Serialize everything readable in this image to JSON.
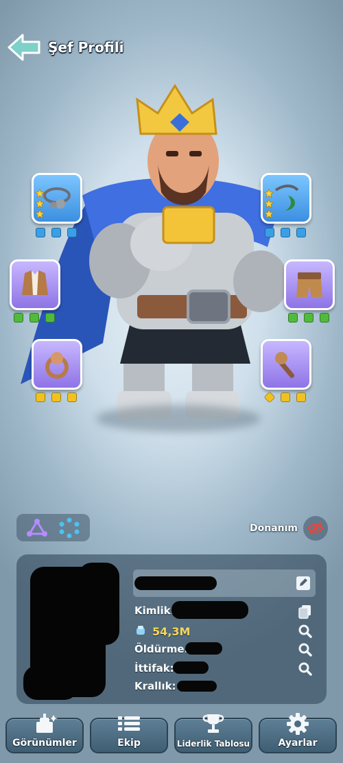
{
  "header": {
    "title": "Şef Profili"
  },
  "equipment": {
    "left": [
      {
        "name": "necklace",
        "gems": 3,
        "gem_color": "blue"
      },
      {
        "name": "armor",
        "gems": 3,
        "gem_color": "green"
      },
      {
        "name": "ring",
        "gems": 3,
        "gem_color": "yellow"
      }
    ],
    "right": [
      {
        "name": "pendant",
        "gems": 3,
        "gem_color": "blue"
      },
      {
        "name": "pants",
        "gems": 3,
        "gem_color": "green"
      },
      {
        "name": "scepter",
        "gems": 3,
        "gem_color": "yellow"
      }
    ]
  },
  "gear_toggle": {
    "label": "Donanım"
  },
  "profile": {
    "id_label": "Kimlik:",
    "power_value": "54,3M",
    "kills_label": "Öldürme:",
    "alliance_label": "İttifak:",
    "kingdom_label": "Krallık:"
  },
  "bottom_nav": [
    {
      "label": "Görünümler",
      "icon": "wardrobe-icon"
    },
    {
      "label": "Ekip",
      "icon": "list-icon"
    },
    {
      "label": "Liderlik Tablosu",
      "icon": "trophy-icon"
    },
    {
      "label": "Ayarlar",
      "icon": "gear-icon"
    }
  ],
  "colors": {
    "accent_gold": "#f6d65a",
    "slot_blue": "#3c8fe0",
    "slot_purple": "#8e74e6",
    "button_bg": "#4d6c82"
  }
}
